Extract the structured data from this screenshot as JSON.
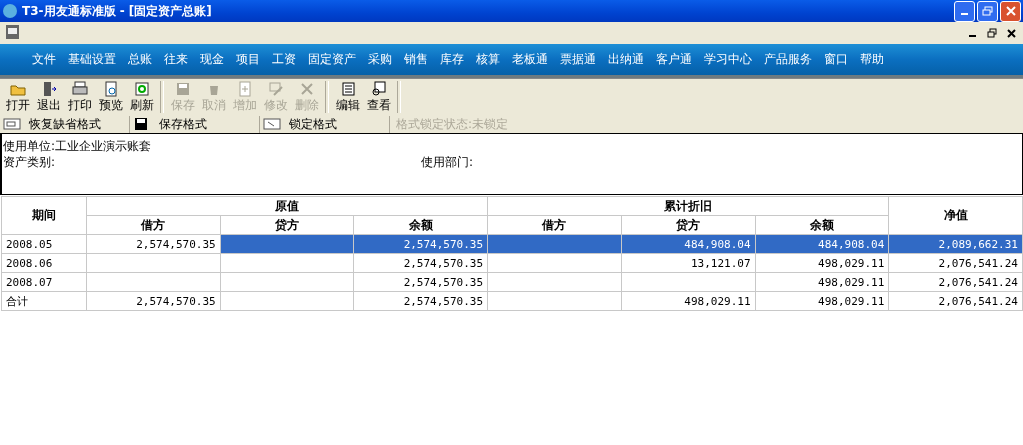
{
  "window": {
    "title": "T3-用友通标准版 - [固定资产总账]"
  },
  "menu": [
    "文件",
    "基础设置",
    "总账",
    "往来",
    "现金",
    "项目",
    "工资",
    "固定资产",
    "采购",
    "销售",
    "库存",
    "核算",
    "老板通",
    "票据通",
    "出纳通",
    "客户通",
    "学习中心",
    "产品服务",
    "窗口",
    "帮助"
  ],
  "toolbar": [
    [
      {
        "label": "打开",
        "disabled": false
      },
      {
        "label": "退出",
        "disabled": false
      },
      {
        "label": "打印",
        "disabled": false
      },
      {
        "label": "预览",
        "disabled": false
      },
      {
        "label": "刷新",
        "disabled": false
      }
    ],
    [
      {
        "label": "保存",
        "disabled": true
      },
      {
        "label": "取消",
        "disabled": true
      },
      {
        "label": "增加",
        "disabled": true
      },
      {
        "label": "修改",
        "disabled": true
      },
      {
        "label": "删除",
        "disabled": true
      }
    ],
    [
      {
        "label": "编辑",
        "disabled": false
      },
      {
        "label": "查看",
        "disabled": false
      }
    ]
  ],
  "format_bar": {
    "buttons": [
      "恢复缺省格式",
      "保存格式",
      "锁定格式"
    ],
    "status": "格式锁定状态:未锁定"
  },
  "info": {
    "unit": "使用单位:工业企业演示账套",
    "category": "资产类别:",
    "department": "使用部门:"
  },
  "table": {
    "period_header": "期间",
    "groups": [
      {
        "label": "原值",
        "columns": [
          "借方",
          "贷方",
          "余额"
        ]
      },
      {
        "label": "累计折旧",
        "columns": [
          "借方",
          "贷方",
          "余额"
        ]
      }
    ],
    "net_header": "净值",
    "rows": [
      {
        "period": "2008.05",
        "cells": [
          "2,574,570.35",
          "",
          "2,574,570.35",
          "",
          "484,908.04",
          "484,908.04",
          "2,089,662.31"
        ],
        "selected": true
      },
      {
        "period": "2008.06",
        "cells": [
          "",
          "",
          "2,574,570.35",
          "",
          "13,121.07",
          "498,029.11",
          "2,076,541.24"
        ],
        "selected": false
      },
      {
        "period": "2008.07",
        "cells": [
          "",
          "",
          "2,574,570.35",
          "",
          "",
          "498,029.11",
          "2,076,541.24"
        ],
        "selected": false
      },
      {
        "period": "合计",
        "cells": [
          "2,574,570.35",
          "",
          "2,574,570.35",
          "",
          "498,029.11",
          "498,029.11",
          "2,076,541.24"
        ],
        "selected": false
      }
    ]
  }
}
